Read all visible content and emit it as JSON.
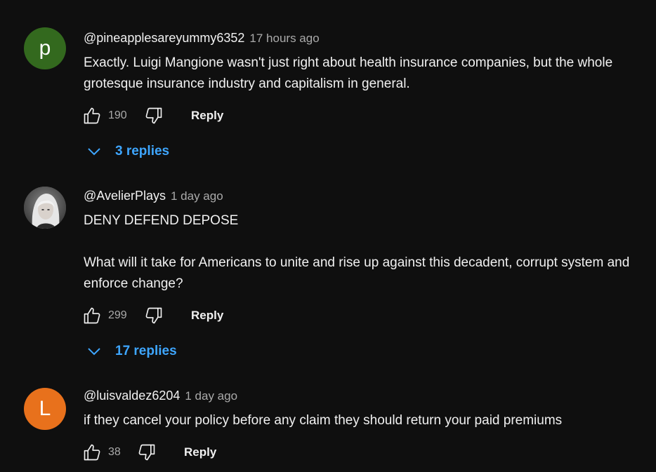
{
  "comments": [
    {
      "avatar_letter": "p",
      "avatar_color": "#33691e",
      "author": "@pineapplesareyummy6352",
      "time": "17 hours ago",
      "text_lines": [
        "Exactly. Luigi Mangione wasn't just right about health insurance companies, but the whole grotesque insurance industry and capitalism in general."
      ],
      "likes": "190",
      "reply_label": "Reply",
      "replies_label": "3 replies"
    },
    {
      "avatar_letter": "",
      "avatar_color": "#6b6b6b",
      "author": "@AvelierPlays",
      "time": "1 day ago",
      "text_line1": "DENY DEFEND DEPOSE",
      "text_line2": "What will it take for Americans to unite and rise up against this decadent, corrupt system and enforce change?",
      "likes": "299",
      "reply_label": "Reply",
      "replies_label": "17 replies"
    },
    {
      "avatar_letter": "L",
      "avatar_color": "#e8711c",
      "author": "@luisvaldez6204",
      "time": "1 day ago",
      "text_lines": [
        "if they cancel your policy before any claim they should return your paid premiums"
      ],
      "likes": "38",
      "reply_label": "Reply"
    }
  ],
  "icons": {
    "like": "thumbs-up-icon",
    "dislike": "thumbs-down-icon",
    "expand": "chevron-down-icon"
  },
  "colors": {
    "background": "#0f0f0f",
    "link": "#3ea6ff",
    "secondary_text": "#aaaaaa"
  }
}
